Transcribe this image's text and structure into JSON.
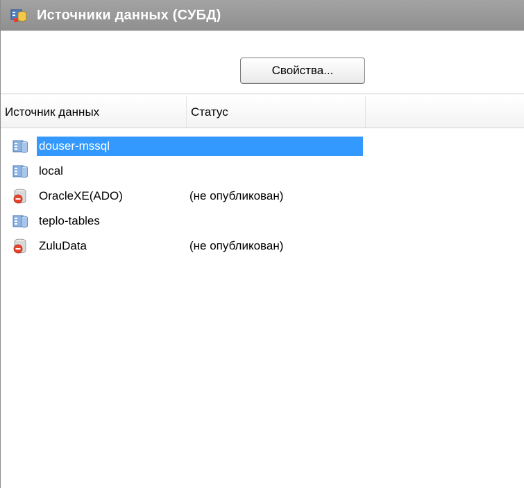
{
  "window": {
    "title": "Источники данных (СУБД)",
    "title_icon": "datasource-window-icon"
  },
  "toolbar": {
    "properties_label": "Свойства..."
  },
  "list": {
    "columns": [
      "Источник данных",
      "Статус"
    ],
    "selected_index": 0,
    "rows": [
      {
        "name": "douser-mssql",
        "status": "",
        "icon": "database-table-icon"
      },
      {
        "name": "local",
        "status": "",
        "icon": "database-table-icon"
      },
      {
        "name": "OracleXE(ADO)",
        "status": "(не опубликован)",
        "icon": "database-unpublished-icon"
      },
      {
        "name": "teplo-tables",
        "status": "",
        "icon": "database-table-icon"
      },
      {
        "name": "ZuluData",
        "status": "(не опубликован)",
        "icon": "database-unpublished-icon"
      }
    ]
  },
  "colors": {
    "titlebar": "#999999",
    "selection": "#3399ff",
    "unpublished_icon": "#e8442a",
    "table_icon": "#5b9bd5"
  }
}
